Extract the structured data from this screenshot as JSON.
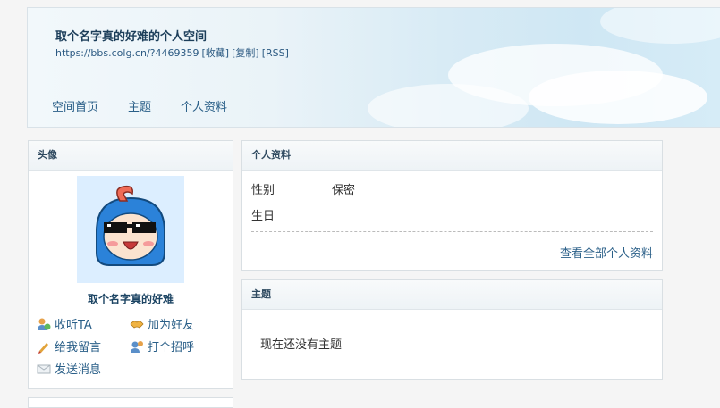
{
  "header": {
    "title": "取个名字真的好难的个人空间",
    "url": "https://bbs.colg.cn/?4469359",
    "links": [
      "[收藏]",
      "[复制]",
      "[RSS]"
    ],
    "nav": [
      "空间首页",
      "主题",
      "个人资料"
    ]
  },
  "avatar_panel": {
    "heading": "头像",
    "username": "取个名字真的好难",
    "actions": [
      {
        "label": "收听TA",
        "icon": "listen-icon"
      },
      {
        "label": "加为好友",
        "icon": "handshake-icon"
      },
      {
        "label": "给我留言",
        "icon": "pencil-icon"
      },
      {
        "label": "打个招呼",
        "icon": "greet-icon"
      },
      {
        "label": "发送消息",
        "icon": "envelope-icon"
      }
    ]
  },
  "profile_panel": {
    "heading": "个人资料",
    "fields": [
      {
        "label": "性别",
        "value": "保密"
      },
      {
        "label": "生日",
        "value": ""
      }
    ],
    "more": "查看全部个人资料"
  },
  "topic_panel": {
    "heading": "主题",
    "empty": "现在还没有主题"
  }
}
